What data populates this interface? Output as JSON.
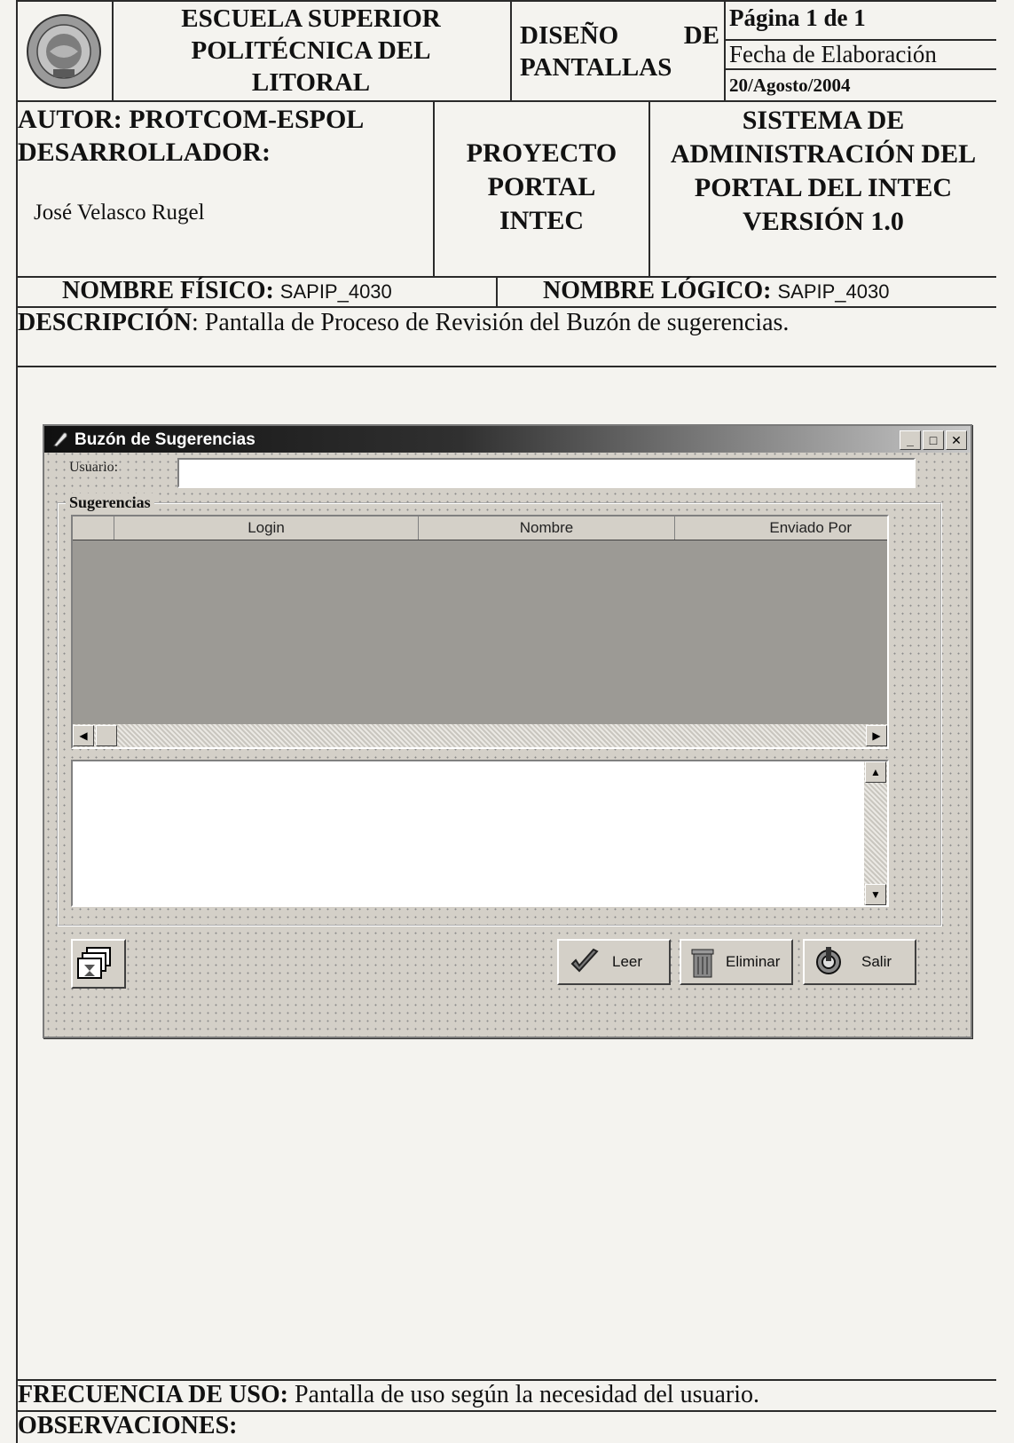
{
  "header": {
    "institution": [
      "ESCUELA SUPERIOR",
      "POLITÉCNICA DEL",
      "LITORAL"
    ],
    "doc_type": [
      "DISEÑO DE",
      "PANTALLAS"
    ],
    "page": "Página 1 de 1",
    "date_label": "Fecha de Elaboración",
    "date_value": "20/Agosto/2004",
    "author": "AUTOR: PROTCOM-ESPOL",
    "developer_label": "DESARROLLADOR:",
    "developer_name": "José Velasco Rugel",
    "project": [
      "PROYECTO",
      "PORTAL",
      "INTEC"
    ],
    "system": [
      "SISTEMA DE",
      "ADMINISTRACIÓN DEL",
      "PORTAL DEL INTEC",
      "VERSIÓN 1.0"
    ],
    "physical_label": "NOMBRE FÍSICO:",
    "physical_value": "SAPIP_4030",
    "logical_label": "NOMBRE LÓGICO:",
    "logical_value": "SAPIP_4030",
    "description_label": "DESCRIPCIÓN",
    "description_value": ": Pantalla de Proceso de Revisión del Buzón de sugerencias."
  },
  "window": {
    "title": "Buzón de Sugerencias",
    "usuario_label": "Usuario:",
    "usuario_value": "",
    "group_label": "Sugerencias",
    "columns": [
      "Login",
      "Nombre",
      "Enviado Por"
    ],
    "message_text": "",
    "buttons": {
      "leer": "Leer",
      "eliminar": "Eliminar",
      "salir": "Salir"
    }
  },
  "footer": {
    "frequency_label": "FRECUENCIA DE USO:",
    "frequency_value": " Pantalla de uso según la necesidad del usuario.",
    "observations_label": "OBSERVACIONES:"
  },
  "colors": {
    "window_face": "#d4d0c8",
    "grid_empty": "#9c9a95",
    "titlebar": "#101010"
  }
}
